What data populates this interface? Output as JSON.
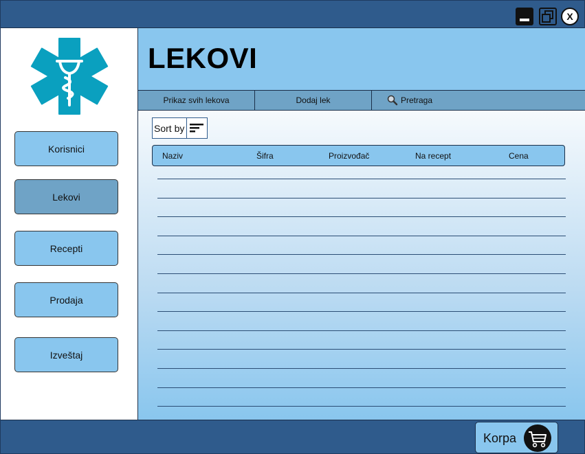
{
  "window": {
    "controls": {
      "minimize_icon": "minimize-icon",
      "restore_icon": "restore-icon",
      "close_label": "X"
    }
  },
  "sidebar": {
    "logo_icon": "star-of-life-caduceus-icon",
    "items": [
      {
        "label": "Korisnici",
        "active": false
      },
      {
        "label": "Lekovi",
        "active": true
      },
      {
        "label": "Recepti",
        "active": false
      },
      {
        "label": "Prodaja",
        "active": false
      },
      {
        "label": "Izveštaj",
        "active": false
      }
    ]
  },
  "header": {
    "title": "LEKOVI"
  },
  "tabs": [
    {
      "label": "Prikaz svih lekova"
    },
    {
      "label": "Dodaj lek"
    },
    {
      "label": "Pretraga",
      "icon": "search-icon"
    }
  ],
  "sort": {
    "label": "Sort by",
    "icon": "sort-icon"
  },
  "table": {
    "columns": [
      "Naziv",
      "Šifra",
      "Proizvođač",
      "Na recept",
      "Cena"
    ],
    "empty_rows": 13
  },
  "footer": {
    "cart_label": "Korpa",
    "cart_icon": "shopping-cart-icon"
  },
  "colors": {
    "titlebar": "#2f5b8c",
    "accent_light": "#89c6ee",
    "accent_active": "#6fa3c6",
    "logo": "#0aa0bf"
  }
}
